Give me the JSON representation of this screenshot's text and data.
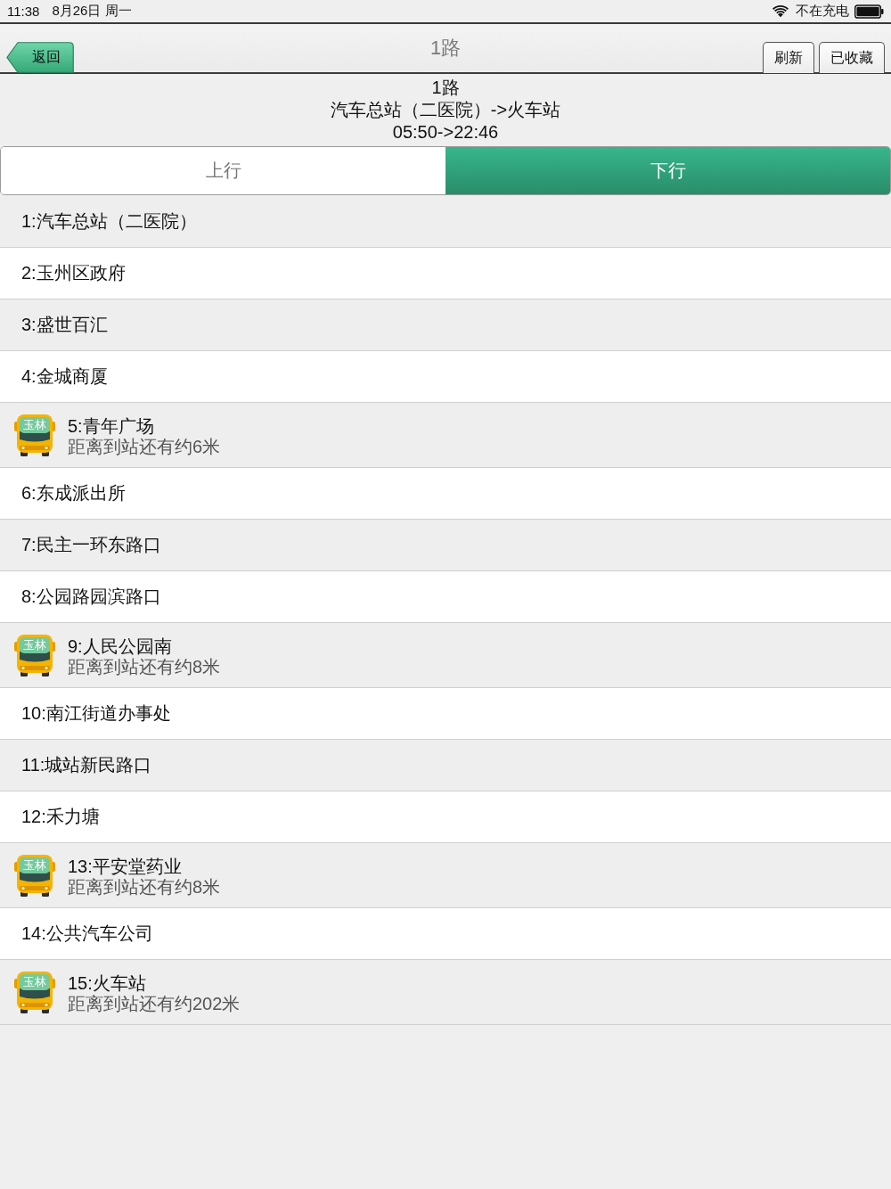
{
  "status_bar": {
    "time": "11:38",
    "date": "8月26日 周一",
    "charging_text": "不在充电"
  },
  "nav_bar": {
    "back_button": "返回",
    "title": "1路",
    "buttons": [
      "刷新",
      "已收藏"
    ]
  },
  "route_info": {
    "name": "1路",
    "direction": "汽车总站（二医院）->火车站",
    "hours": "05:50->22:46"
  },
  "tabs": [
    {
      "label": "上行",
      "selected": false
    },
    {
      "label": "下行",
      "selected": true
    }
  ],
  "stops": [
    {
      "label": "1:汽车总站（二医院）"
    },
    {
      "label": "2:玉州区政府"
    },
    {
      "label": "3:盛世百汇"
    },
    {
      "label": "4:金城商厦"
    },
    {
      "label": "5:青年广场",
      "bus": {
        "sign": "玉林",
        "distance": "距离到站还有约6米"
      }
    },
    {
      "label": "6:东成派出所"
    },
    {
      "label": "7:民主一环东路口"
    },
    {
      "label": "8:公园路园滨路口"
    },
    {
      "label": "9:人民公园南",
      "bus": {
        "sign": "玉林",
        "distance": "距离到站还有约8米"
      }
    },
    {
      "label": "10:南江街道办事处"
    },
    {
      "label": "11:城站新民路口"
    },
    {
      "label": "12:禾力塘"
    },
    {
      "label": "13:平安堂药业",
      "bus": {
        "sign": "玉林",
        "distance": "距离到站还有约8米"
      }
    },
    {
      "label": "14:公共汽车公司"
    },
    {
      "label": "15:火车站",
      "bus": {
        "sign": "玉林",
        "distance": "距离到站还有约202米"
      }
    }
  ]
}
